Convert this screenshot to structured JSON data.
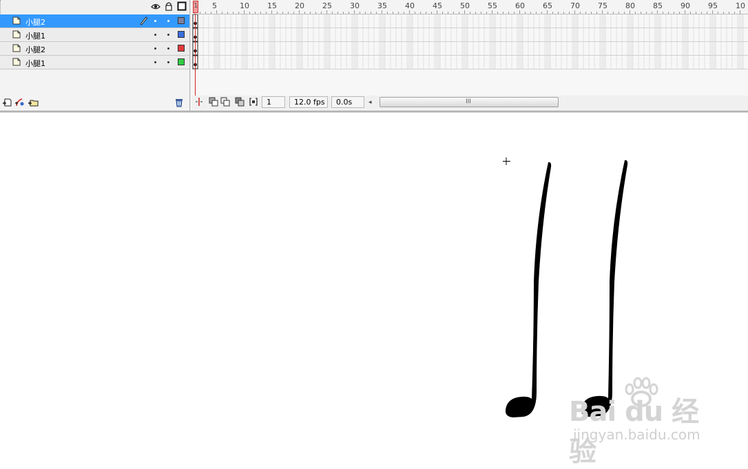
{
  "timeline": {
    "layers": [
      {
        "name": "小腿2",
        "selected": true,
        "color": "#7f7f9f",
        "editing": true
      },
      {
        "name": "小腿1",
        "selected": false,
        "color": "#3a6fdd"
      },
      {
        "name": "小腿2",
        "selected": false,
        "color": "#e23b3b"
      },
      {
        "name": "小腿1",
        "selected": false,
        "color": "#33cc44"
      }
    ],
    "header_icons": [
      "eye-icon",
      "lock-icon",
      "outline-icon"
    ],
    "tool_icons": [
      "insert-layer-icon",
      "add-motion-guide-icon",
      "insert-layer-folder-icon",
      "trash-icon"
    ],
    "ruler_labels": [
      "1",
      "5",
      "10",
      "15",
      "20",
      "25",
      "30",
      "35",
      "40",
      "45",
      "50",
      "55",
      "60",
      "65",
      "70",
      "75",
      "80",
      "85",
      "90",
      "95",
      "10"
    ],
    "current_frame": "1",
    "frame_rate": "12.0 fps",
    "elapsed_time": "0.0s",
    "scroll_grip": "III"
  },
  "stage": {
    "cursor": "crosshair-icon"
  },
  "watermark": {
    "brand": "Bai du 经验",
    "url": "jingyan.baidu.com"
  }
}
